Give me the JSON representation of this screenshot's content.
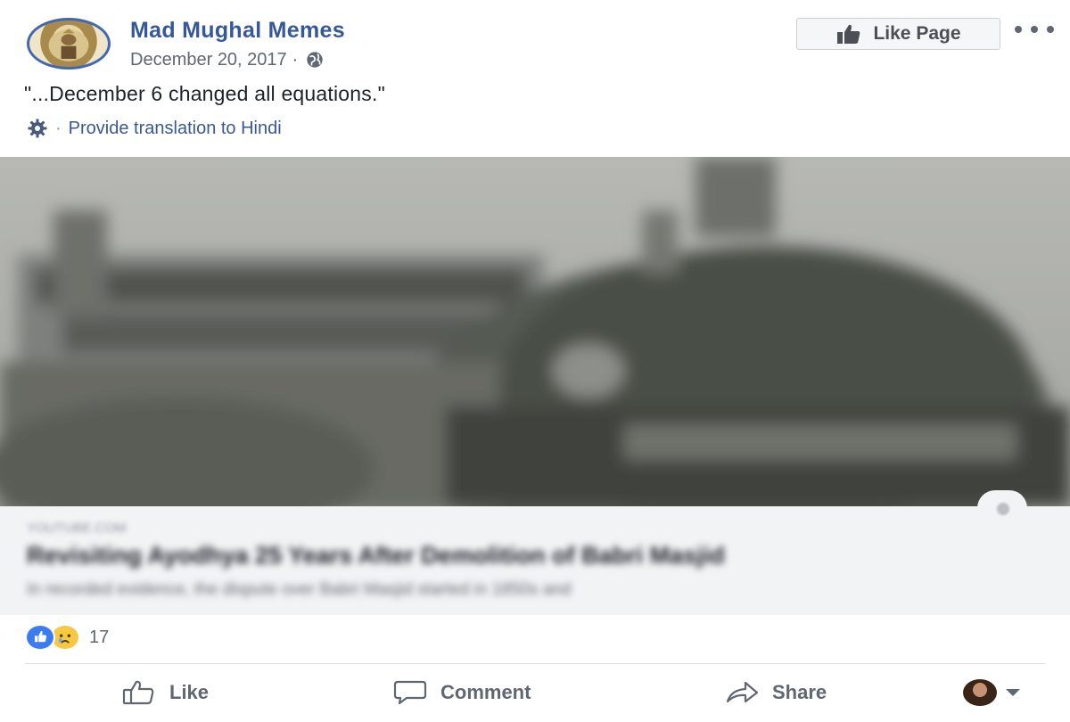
{
  "header": {
    "page_name": "Mad Mughal Memes",
    "date": "December 20, 2017",
    "separator": "·",
    "like_page_label": "Like Page"
  },
  "post": {
    "text": "\"...December 6 changed all equations.\"",
    "translate_separator": "·",
    "translate_label": "Provide translation to Hindi"
  },
  "link_preview": {
    "domain": "youtube.com",
    "title": "Revisiting Ayodhya 25 Years After Demolition of Babri Masjid",
    "description": "In recorded evidence, the dispute over Babri Masjid started in 1850s and"
  },
  "reactions": {
    "icons": [
      "like-reaction",
      "sad-reaction"
    ],
    "count": "17"
  },
  "actions": {
    "like_label": "Like",
    "comment_label": "Comment",
    "share_label": "Share"
  },
  "colors": {
    "link_blue": "#365899",
    "accent_blue": "#4267b2",
    "muted_text": "#606770"
  }
}
